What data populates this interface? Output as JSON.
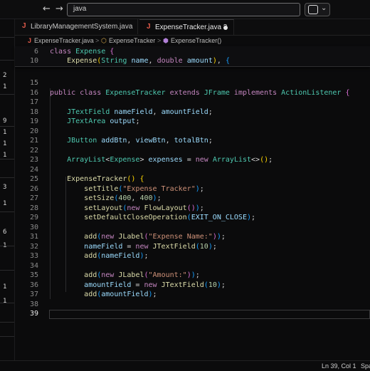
{
  "titlebar": {
    "back_glyph": "←",
    "forward_glyph": "→",
    "search_value": "java",
    "chevron_glyph": "⌄"
  },
  "gutter": {
    "counts": [
      "2",
      "1",
      "9",
      "1",
      "1",
      "1",
      "3",
      "1",
      "6",
      "1",
      "1",
      "1"
    ]
  },
  "tabs": [
    {
      "icon": "J",
      "label": "LibraryManagementSystem.java",
      "active": false
    },
    {
      "icon": "J",
      "label": "ExpenseTracker.java 3",
      "active": true
    }
  ],
  "breadcrumb": {
    "file_icon": "J",
    "file": "ExpenseTracker.java",
    "sep": ">",
    "class_icon": "⬡",
    "class_name": "ExpenseTracker",
    "method_icon": "⬢",
    "method": "ExpenseTracker()"
  },
  "sticky_lines": [
    {
      "n": "6",
      "tokens": [
        [
          "kw",
          "class "
        ],
        [
          "cl",
          "Expense "
        ],
        [
          "br1",
          "{"
        ]
      ]
    },
    {
      "n": "10",
      "tokens": [
        [
          "",
          "    "
        ],
        [
          "fn",
          "Expense"
        ],
        [
          "br2",
          "("
        ],
        [
          "ty",
          "String "
        ],
        [
          "var",
          "name"
        ],
        [
          "",
          ", "
        ],
        [
          "kw",
          "double "
        ],
        [
          "var",
          "amount"
        ],
        [
          "br2",
          ")"
        ],
        [
          "",
          ", "
        ],
        [
          "br3",
          "{"
        ]
      ]
    }
  ],
  "code_lines": [
    {
      "n": "15",
      "tokens": []
    },
    {
      "n": "16",
      "tokens": [
        [
          "kw",
          "public class "
        ],
        [
          "cl",
          "ExpenseTracker "
        ],
        [
          "kw",
          "extends "
        ],
        [
          "cl",
          "JFrame "
        ],
        [
          "kw",
          "implements "
        ],
        [
          "cl",
          "ActionListener "
        ],
        [
          "br1",
          "{"
        ]
      ]
    },
    {
      "n": "17",
      "tokens": []
    },
    {
      "n": "18",
      "tokens": [
        [
          "",
          "    "
        ],
        [
          "ty",
          "JTextField "
        ],
        [
          "var",
          "nameField"
        ],
        [
          "",
          ", "
        ],
        [
          "var",
          "amountField"
        ],
        [
          "",
          ";"
        ]
      ]
    },
    {
      "n": "19",
      "tokens": [
        [
          "",
          "    "
        ],
        [
          "ty",
          "JTextArea "
        ],
        [
          "var",
          "output"
        ],
        [
          "",
          ";"
        ]
      ]
    },
    {
      "n": "20",
      "tokens": []
    },
    {
      "n": "21",
      "tokens": [
        [
          "",
          "    "
        ],
        [
          "ty",
          "JButton "
        ],
        [
          "var",
          "addBtn"
        ],
        [
          "",
          ", "
        ],
        [
          "var",
          "viewBtn"
        ],
        [
          "",
          ", "
        ],
        [
          "var",
          "totalBtn"
        ],
        [
          "",
          ";"
        ]
      ]
    },
    {
      "n": "22",
      "tokens": []
    },
    {
      "n": "23",
      "tokens": [
        [
          "",
          "    "
        ],
        [
          "ty",
          "ArrayList"
        ],
        [
          "",
          "<"
        ],
        [
          "ty",
          "Expense"
        ],
        [
          "",
          "> "
        ],
        [
          "var",
          "expenses"
        ],
        [
          "",
          " = "
        ],
        [
          "kw",
          "new "
        ],
        [
          "ty",
          "ArrayList"
        ],
        [
          "",
          "<>"
        ],
        [
          "br2",
          "()"
        ],
        [
          "",
          ";"
        ]
      ]
    },
    {
      "n": "24",
      "tokens": []
    },
    {
      "n": "25",
      "tokens": [
        [
          "",
          "    "
        ],
        [
          "fn",
          "ExpenseTracker"
        ],
        [
          "br2",
          "() "
        ],
        [
          "br2",
          "{"
        ]
      ]
    },
    {
      "n": "26",
      "tokens": [
        [
          "",
          "        "
        ],
        [
          "fn",
          "setTitle"
        ],
        [
          "br3",
          "("
        ],
        [
          "str",
          "\"Expense Tracker\""
        ],
        [
          "br3",
          ")"
        ],
        [
          "",
          ";"
        ]
      ]
    },
    {
      "n": "27",
      "tokens": [
        [
          "",
          "        "
        ],
        [
          "fn",
          "setSize"
        ],
        [
          "br3",
          "("
        ],
        [
          "num",
          "400"
        ],
        [
          "",
          ", "
        ],
        [
          "num",
          "400"
        ],
        [
          "br3",
          ")"
        ],
        [
          "",
          ";"
        ]
      ]
    },
    {
      "n": "28",
      "tokens": [
        [
          "",
          "        "
        ],
        [
          "fn",
          "setLayout"
        ],
        [
          "br3",
          "("
        ],
        [
          "kw",
          "new "
        ],
        [
          "fn",
          "FlowLayout"
        ],
        [
          "br1",
          "()"
        ],
        [
          "br3",
          ")"
        ],
        [
          "",
          ";"
        ]
      ]
    },
    {
      "n": "29",
      "tokens": [
        [
          "",
          "        "
        ],
        [
          "fn",
          "setDefaultCloseOperation"
        ],
        [
          "br3",
          "("
        ],
        [
          "var",
          "EXIT_ON_CLOSE"
        ],
        [
          "br3",
          ")"
        ],
        [
          "",
          ";"
        ]
      ]
    },
    {
      "n": "30",
      "tokens": []
    },
    {
      "n": "31",
      "tokens": [
        [
          "",
          "        "
        ],
        [
          "fn",
          "add"
        ],
        [
          "br3",
          "("
        ],
        [
          "kw",
          "new "
        ],
        [
          "fn",
          "JLabel"
        ],
        [
          "br1",
          "("
        ],
        [
          "str",
          "\"Expense Name:\""
        ],
        [
          "br1",
          ")"
        ],
        [
          "br3",
          ")"
        ],
        [
          "",
          ";"
        ]
      ]
    },
    {
      "n": "32",
      "tokens": [
        [
          "",
          "        "
        ],
        [
          "var",
          "nameField"
        ],
        [
          "",
          " = "
        ],
        [
          "kw",
          "new "
        ],
        [
          "fn",
          "JTextField"
        ],
        [
          "br3",
          "("
        ],
        [
          "num",
          "10"
        ],
        [
          "br3",
          ")"
        ],
        [
          "",
          ";"
        ]
      ]
    },
    {
      "n": "33",
      "tokens": [
        [
          "",
          "        "
        ],
        [
          "fn",
          "add"
        ],
        [
          "br3",
          "("
        ],
        [
          "var",
          "nameField"
        ],
        [
          "br3",
          ")"
        ],
        [
          "",
          ";"
        ]
      ]
    },
    {
      "n": "34",
      "tokens": []
    },
    {
      "n": "35",
      "tokens": [
        [
          "",
          "        "
        ],
        [
          "fn",
          "add"
        ],
        [
          "br3",
          "("
        ],
        [
          "kw",
          "new "
        ],
        [
          "fn",
          "JLabel"
        ],
        [
          "br1",
          "("
        ],
        [
          "str",
          "\"Amount:\""
        ],
        [
          "br1",
          ")"
        ],
        [
          "br3",
          ")"
        ],
        [
          "",
          ";"
        ]
      ]
    },
    {
      "n": "36",
      "tokens": [
        [
          "",
          "        "
        ],
        [
          "var",
          "amountField"
        ],
        [
          "",
          " = "
        ],
        [
          "kw",
          "new "
        ],
        [
          "fn",
          "JTextField"
        ],
        [
          "br3",
          "("
        ],
        [
          "num",
          "10"
        ],
        [
          "br3",
          ")"
        ],
        [
          "",
          ";"
        ]
      ]
    },
    {
      "n": "37",
      "tokens": [
        [
          "",
          "        "
        ],
        [
          "fn",
          "add"
        ],
        [
          "br3",
          "("
        ],
        [
          "var",
          "amountField"
        ],
        [
          "br3",
          ")"
        ],
        [
          "",
          ";"
        ]
      ]
    },
    {
      "n": "38",
      "tokens": []
    },
    {
      "n": "39",
      "tokens": [],
      "current": true
    }
  ],
  "statusbar": {
    "position": "Ln 39, Col 1",
    "spaces": "Spa"
  }
}
